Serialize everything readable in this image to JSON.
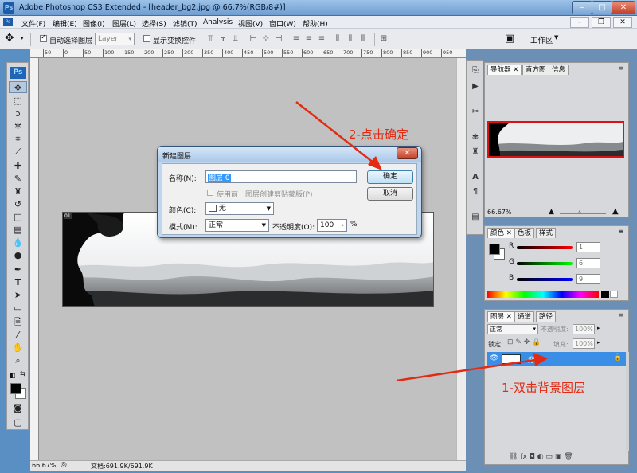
{
  "window": {
    "title": "Adobe Photoshop CS3 Extended - [header_bg2.jpg @ 66.7%(RGB/8#)]",
    "app_icon": "Ps"
  },
  "menu": {
    "items": [
      "文件(F)",
      "编辑(E)",
      "图像(I)",
      "图层(L)",
      "选择(S)",
      "滤镜(T)",
      "Analysis",
      "视图(V)",
      "窗口(W)",
      "帮助(H)"
    ]
  },
  "options_bar": {
    "auto_select_label": "自动选择图层",
    "auto_select_value": "Layer",
    "show_transform_label": "显示变换控件",
    "workspace_label": "工作区"
  },
  "rulers": {
    "top_ticks": [
      "50",
      "0",
      "50",
      "100",
      "150",
      "200",
      "250",
      "300",
      "350",
      "400",
      "450",
      "500",
      "550",
      "600",
      "650",
      "700",
      "750",
      "800",
      "850",
      "900",
      "950"
    ]
  },
  "status": {
    "zoom": "66.67%",
    "doc_info": "文档:691.9K/691.9K"
  },
  "canvas": {
    "layer_badge": "01"
  },
  "dialog": {
    "title": "新建图层",
    "name_label": "名称(N):",
    "name_value": "图层 0",
    "clip_checkbox": "使用前一图层创建剪贴蒙版(P)",
    "color_label": "颜色(C):",
    "color_value": "无",
    "mode_label": "模式(M):",
    "mode_value": "正常",
    "opacity_label": "不透明度(O):",
    "opacity_value": "100",
    "opacity_unit": "%",
    "ok_label": "确定",
    "cancel_label": "取消"
  },
  "navigator": {
    "tabs": [
      "导航器",
      "直方图",
      "信息"
    ],
    "zoom": "66.67%"
  },
  "color_panel": {
    "tabs": [
      "颜色",
      "色板",
      "样式"
    ],
    "r": "1",
    "g": "6",
    "b": "9",
    "r_label": "R",
    "g_label": "G",
    "b_label": "B"
  },
  "layers_panel": {
    "tabs": [
      "图层",
      "通道",
      "路径"
    ],
    "blend_mode": "正常",
    "opacity_label": "不透明度:",
    "opacity_value": "100%",
    "lock_label": "锁定:",
    "fill_label": "填充:",
    "fill_value": "100%",
    "layer_name": "背景"
  },
  "annotations": {
    "step1": "1-双击背景图层",
    "step2": "2-点击确定"
  },
  "colors": {
    "accent": "#3a8ee6",
    "annotation": "#e32a12"
  }
}
